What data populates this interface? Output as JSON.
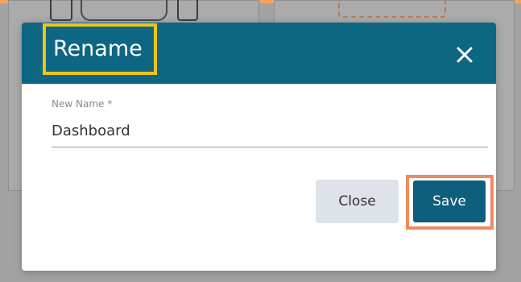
{
  "modal": {
    "title": "Rename",
    "close_icon": "close-icon",
    "field": {
      "label": "New Name *",
      "value": "Dashboard"
    },
    "buttons": {
      "close_label": "Close",
      "save_label": "Save"
    }
  },
  "colors": {
    "header": "#0d6682",
    "save_button": "#0d5f7d",
    "close_button": "#dde3e9",
    "title_highlight": "#f0c419",
    "save_highlight": "#f08a5d"
  }
}
